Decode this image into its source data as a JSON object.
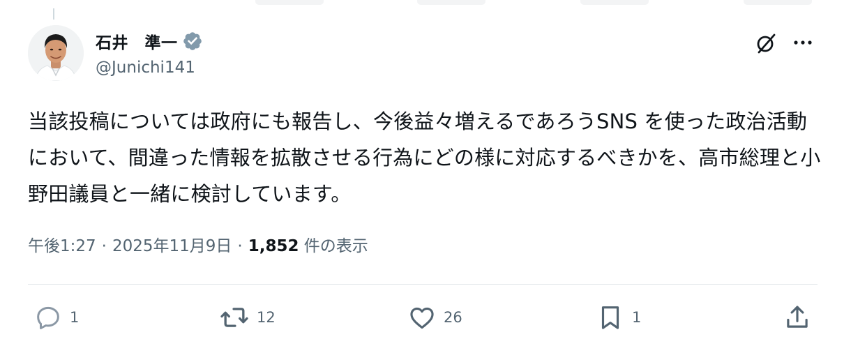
{
  "author": {
    "display_name": "石井　準一",
    "handle": "@Junichi141",
    "verified": true,
    "verified_color": "#829aab"
  },
  "post": {
    "text": "当該投稿については政府にも報告し、今後益々増えるであろうSNS を使った政治活動において、間違った情報を拡散させる行為にどの様に対応するべきかを、高市総理と小野田議員と一緒に検討しています。"
  },
  "meta": {
    "time": "午後1:27",
    "separator": "·",
    "date": "2025年11月9日",
    "views_count": "1,852",
    "views_label": "件の表示"
  },
  "actions": {
    "reply_count": "1",
    "repost_count": "12",
    "like_count": "26",
    "bookmark_count": "1"
  },
  "icons": {
    "header": [
      "grok-icon",
      "more-icon"
    ],
    "action_bar": [
      "reply-icon",
      "repost-icon",
      "like-icon",
      "bookmark-icon",
      "share-icon"
    ]
  },
  "colors": {
    "text": "#0f1419",
    "secondary": "#536471",
    "divider": "#e4e8eb"
  }
}
